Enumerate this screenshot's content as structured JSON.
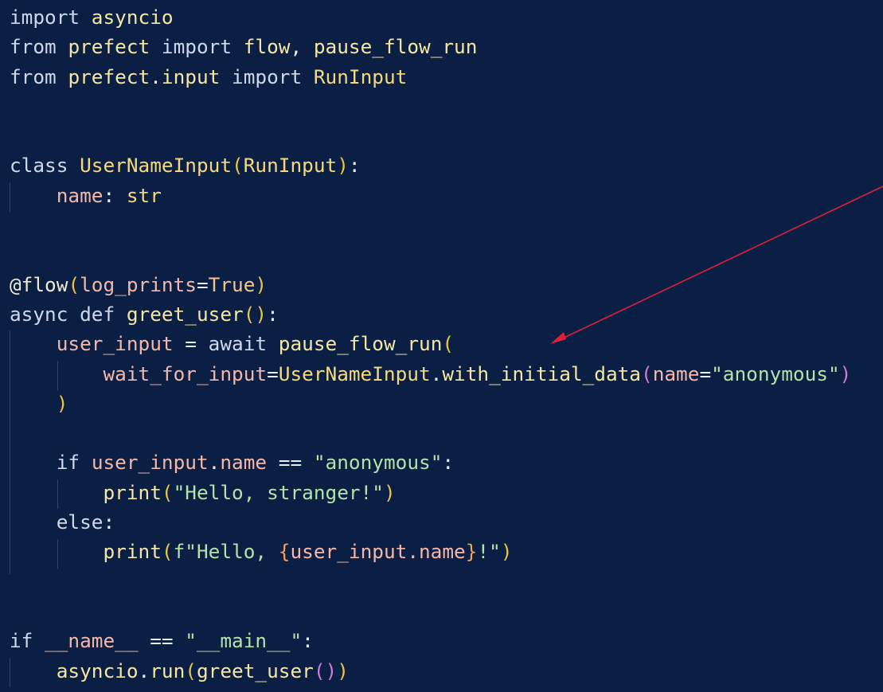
{
  "colors": {
    "background": "#0b1f45",
    "keyword": "#cfd8ea",
    "default": "#e8ecf4",
    "function": "#f5e6a3",
    "class": "#f6d97b",
    "paren": "#e8c547",
    "paren_nested": "#d27ad6",
    "string": "#b3e3a8",
    "attribute": "#f4b7a8",
    "decorator": "#f0ead2",
    "constant": "#f0c58a",
    "fstring_brace": "#f0a15a",
    "annotation_arrow": "#e01e37"
  },
  "lines": [
    [
      {
        "t": "import",
        "c": "keyword"
      },
      {
        "t": " ",
        "c": "default"
      },
      {
        "t": "asyncio",
        "c": "function"
      }
    ],
    [
      {
        "t": "from",
        "c": "keyword"
      },
      {
        "t": " ",
        "c": "default"
      },
      {
        "t": "prefect",
        "c": "function"
      },
      {
        "t": " ",
        "c": "default"
      },
      {
        "t": "import",
        "c": "keyword"
      },
      {
        "t": " ",
        "c": "default"
      },
      {
        "t": "flow",
        "c": "function"
      },
      {
        "t": ", ",
        "c": "default"
      },
      {
        "t": "pause_flow_run",
        "c": "function"
      }
    ],
    [
      {
        "t": "from",
        "c": "keyword"
      },
      {
        "t": " ",
        "c": "default"
      },
      {
        "t": "prefect",
        "c": "function"
      },
      {
        "t": ".",
        "c": "default"
      },
      {
        "t": "input",
        "c": "function"
      },
      {
        "t": " ",
        "c": "default"
      },
      {
        "t": "import",
        "c": "keyword"
      },
      {
        "t": " ",
        "c": "default"
      },
      {
        "t": "RunInput",
        "c": "class"
      }
    ],
    [],
    [],
    [
      {
        "t": "class",
        "c": "keyword"
      },
      {
        "t": " ",
        "c": "default"
      },
      {
        "t": "UserNameInput",
        "c": "class"
      },
      {
        "t": "(",
        "c": "paren"
      },
      {
        "t": "RunInput",
        "c": "class"
      },
      {
        "t": ")",
        "c": "paren"
      },
      {
        "t": ":",
        "c": "default"
      }
    ],
    [
      {
        "t": "    ",
        "c": "default"
      },
      {
        "t": "name",
        "c": "attribute"
      },
      {
        "t": ": ",
        "c": "default"
      },
      {
        "t": "str",
        "c": "class"
      }
    ],
    [],
    [],
    [
      {
        "t": "@flow",
        "c": "decorator"
      },
      {
        "t": "(",
        "c": "paren"
      },
      {
        "t": "log_prints",
        "c": "attribute"
      },
      {
        "t": "=",
        "c": "default"
      },
      {
        "t": "True",
        "c": "constant"
      },
      {
        "t": ")",
        "c": "paren"
      }
    ],
    [
      {
        "t": "async",
        "c": "keyword"
      },
      {
        "t": " ",
        "c": "default"
      },
      {
        "t": "def",
        "c": "keyword"
      },
      {
        "t": " ",
        "c": "default"
      },
      {
        "t": "greet_user",
        "c": "function"
      },
      {
        "t": "()",
        "c": "paren"
      },
      {
        "t": ":",
        "c": "default"
      }
    ],
    [
      {
        "t": "    ",
        "c": "default"
      },
      {
        "t": "user_input",
        "c": "attribute"
      },
      {
        "t": " = ",
        "c": "default"
      },
      {
        "t": "await",
        "c": "keyword"
      },
      {
        "t": " ",
        "c": "default"
      },
      {
        "t": "pause_flow_run",
        "c": "function"
      },
      {
        "t": "(",
        "c": "paren"
      }
    ],
    [
      {
        "t": "        ",
        "c": "default"
      },
      {
        "t": "wait_for_input",
        "c": "attribute"
      },
      {
        "t": "=",
        "c": "default"
      },
      {
        "t": "UserNameInput",
        "c": "class"
      },
      {
        "t": ".",
        "c": "default"
      },
      {
        "t": "with_initial_data",
        "c": "function"
      },
      {
        "t": "(",
        "c": "paren_nested"
      },
      {
        "t": "name",
        "c": "attribute"
      },
      {
        "t": "=",
        "c": "default"
      },
      {
        "t": "\"anonymous\"",
        "c": "string"
      },
      {
        "t": ")",
        "c": "paren_nested"
      }
    ],
    [
      {
        "t": "    ",
        "c": "default"
      },
      {
        "t": ")",
        "c": "paren"
      }
    ],
    [],
    [
      {
        "t": "    ",
        "c": "default"
      },
      {
        "t": "if",
        "c": "keyword"
      },
      {
        "t": " ",
        "c": "default"
      },
      {
        "t": "user_input",
        "c": "attribute"
      },
      {
        "t": ".",
        "c": "default"
      },
      {
        "t": "name",
        "c": "attribute"
      },
      {
        "t": " == ",
        "c": "default"
      },
      {
        "t": "\"anonymous\"",
        "c": "string"
      },
      {
        "t": ":",
        "c": "default"
      }
    ],
    [
      {
        "t": "        ",
        "c": "default"
      },
      {
        "t": "print",
        "c": "function"
      },
      {
        "t": "(",
        "c": "paren"
      },
      {
        "t": "\"Hello, stranger!\"",
        "c": "string"
      },
      {
        "t": ")",
        "c": "paren"
      }
    ],
    [
      {
        "t": "    ",
        "c": "default"
      },
      {
        "t": "else",
        "c": "keyword"
      },
      {
        "t": ":",
        "c": "default"
      }
    ],
    [
      {
        "t": "        ",
        "c": "default"
      },
      {
        "t": "print",
        "c": "function"
      },
      {
        "t": "(",
        "c": "paren"
      },
      {
        "t": "f\"Hello, ",
        "c": "string"
      },
      {
        "t": "{",
        "c": "fstring_brace"
      },
      {
        "t": "user_input.name",
        "c": "attribute"
      },
      {
        "t": "}",
        "c": "fstring_brace"
      },
      {
        "t": "!\"",
        "c": "string"
      },
      {
        "t": ")",
        "c": "paren"
      }
    ],
    [],
    [],
    [
      {
        "t": "if",
        "c": "keyword"
      },
      {
        "t": " ",
        "c": "default"
      },
      {
        "t": "__name__",
        "c": "attribute"
      },
      {
        "t": " == ",
        "c": "default"
      },
      {
        "t": "\"__main__\"",
        "c": "string"
      },
      {
        "t": ":",
        "c": "default"
      }
    ],
    [
      {
        "t": "    ",
        "c": "default"
      },
      {
        "t": "asyncio",
        "c": "function"
      },
      {
        "t": ".",
        "c": "default"
      },
      {
        "t": "run",
        "c": "function"
      },
      {
        "t": "(",
        "c": "paren"
      },
      {
        "t": "greet_user",
        "c": "function"
      },
      {
        "t": "()",
        "c": "paren_nested"
      },
      {
        "t": ")",
        "c": "paren"
      }
    ]
  ]
}
